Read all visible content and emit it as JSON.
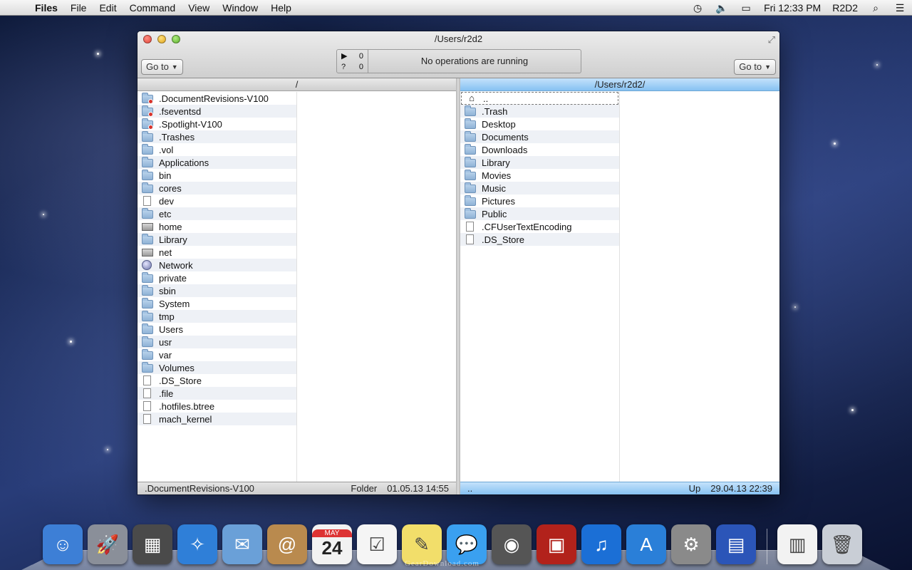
{
  "menubar": {
    "app": "Files",
    "items": [
      "File",
      "Edit",
      "Command",
      "View",
      "Window",
      "Help"
    ],
    "clock": "Fri 12:33 PM",
    "user": "R2D2"
  },
  "window": {
    "title": "/Users/r2d2",
    "goto_left": "Go to",
    "goto_right": "Go to",
    "ops": {
      "running_count": "0",
      "queued_count": "0",
      "message": "No operations are running"
    }
  },
  "left_pane": {
    "path": "/",
    "items": [
      {
        "name": ".DocumentRevisions-V100",
        "icon": "restricted-folder-icon"
      },
      {
        "name": ".fseventsd",
        "icon": "restricted-folder-icon"
      },
      {
        "name": ".Spotlight-V100",
        "icon": "restricted-folder-icon"
      },
      {
        "name": ".Trashes",
        "icon": "folder-icon"
      },
      {
        "name": ".vol",
        "icon": "folder-icon"
      },
      {
        "name": "Applications",
        "icon": "folder-icon"
      },
      {
        "name": "bin",
        "icon": "folder-icon"
      },
      {
        "name": "cores",
        "icon": "folder-icon"
      },
      {
        "name": "dev",
        "icon": "file-icon"
      },
      {
        "name": "etc",
        "icon": "folder-icon"
      },
      {
        "name": "home",
        "icon": "drive-icon"
      },
      {
        "name": "Library",
        "icon": "folder-icon"
      },
      {
        "name": "net",
        "icon": "drive-icon"
      },
      {
        "name": "Network",
        "icon": "globe-icon"
      },
      {
        "name": "private",
        "icon": "folder-icon"
      },
      {
        "name": "sbin",
        "icon": "folder-icon"
      },
      {
        "name": "System",
        "icon": "folder-icon"
      },
      {
        "name": "tmp",
        "icon": "folder-icon"
      },
      {
        "name": "Users",
        "icon": "folder-icon"
      },
      {
        "name": "usr",
        "icon": "folder-icon"
      },
      {
        "name": "var",
        "icon": "folder-icon"
      },
      {
        "name": "Volumes",
        "icon": "folder-icon"
      },
      {
        "name": ".DS_Store",
        "icon": "file-icon"
      },
      {
        "name": ".file",
        "icon": "file-icon"
      },
      {
        "name": ".hotfiles.btree",
        "icon": "file-icon"
      },
      {
        "name": "mach_kernel",
        "icon": "file-icon"
      }
    ],
    "footer": {
      "name": ".DocumentRevisions-V100",
      "kind": "Folder",
      "date": "01.05.13 14:55"
    }
  },
  "right_pane": {
    "path": "/Users/r2d2/",
    "items": [
      {
        "name": "..",
        "icon": "home-icon"
      },
      {
        "name": ".Trash",
        "icon": "folder-icon"
      },
      {
        "name": "Desktop",
        "icon": "folder-icon"
      },
      {
        "name": "Documents",
        "icon": "folder-icon"
      },
      {
        "name": "Downloads",
        "icon": "folder-icon"
      },
      {
        "name": "Library",
        "icon": "folder-icon"
      },
      {
        "name": "Movies",
        "icon": "folder-icon"
      },
      {
        "name": "Music",
        "icon": "folder-icon"
      },
      {
        "name": "Pictures",
        "icon": "folder-icon"
      },
      {
        "name": "Public",
        "icon": "folder-icon"
      },
      {
        "name": ".CFUserTextEncoding",
        "icon": "file-icon"
      },
      {
        "name": ".DS_Store",
        "icon": "file-icon"
      }
    ],
    "footer": {
      "name": "..",
      "kind": "Up",
      "date": "29.04.13 22:39"
    }
  },
  "dock": {
    "apps": [
      {
        "name": "finder-icon",
        "color": "#3d7fd6"
      },
      {
        "name": "launchpad-icon",
        "color": "#8a8f99"
      },
      {
        "name": "dashboard-icon",
        "color": "#4a4a4a"
      },
      {
        "name": "safari-icon",
        "color": "#2f7fd8"
      },
      {
        "name": "mail-icon",
        "color": "#6aa0d8"
      },
      {
        "name": "contacts-icon",
        "color": "#b98a4e"
      },
      {
        "name": "calendar-icon",
        "color": "#f2f2f2"
      },
      {
        "name": "reminders-icon",
        "color": "#f5f5f5"
      },
      {
        "name": "notes-icon",
        "color": "#f2de6a"
      },
      {
        "name": "messages-icon",
        "color": "#3aa0f0"
      },
      {
        "name": "facetime-icon",
        "color": "#555"
      },
      {
        "name": "photobooth-icon",
        "color": "#b2221b"
      },
      {
        "name": "itunes-icon",
        "color": "#1b6fd6"
      },
      {
        "name": "appstore-icon",
        "color": "#2a7fd8"
      },
      {
        "name": "system-preferences-icon",
        "color": "#8a8a8a"
      },
      {
        "name": "files-app-icon",
        "color": "#2b55b8"
      }
    ],
    "docs": [
      {
        "name": "document-stack-icon",
        "color": "#f2f2f2"
      },
      {
        "name": "trash-icon",
        "color": "#c9ced6"
      }
    ],
    "calendar_month": "MAY",
    "calendar_day": "24"
  },
  "watermark": "GearDownload.com"
}
